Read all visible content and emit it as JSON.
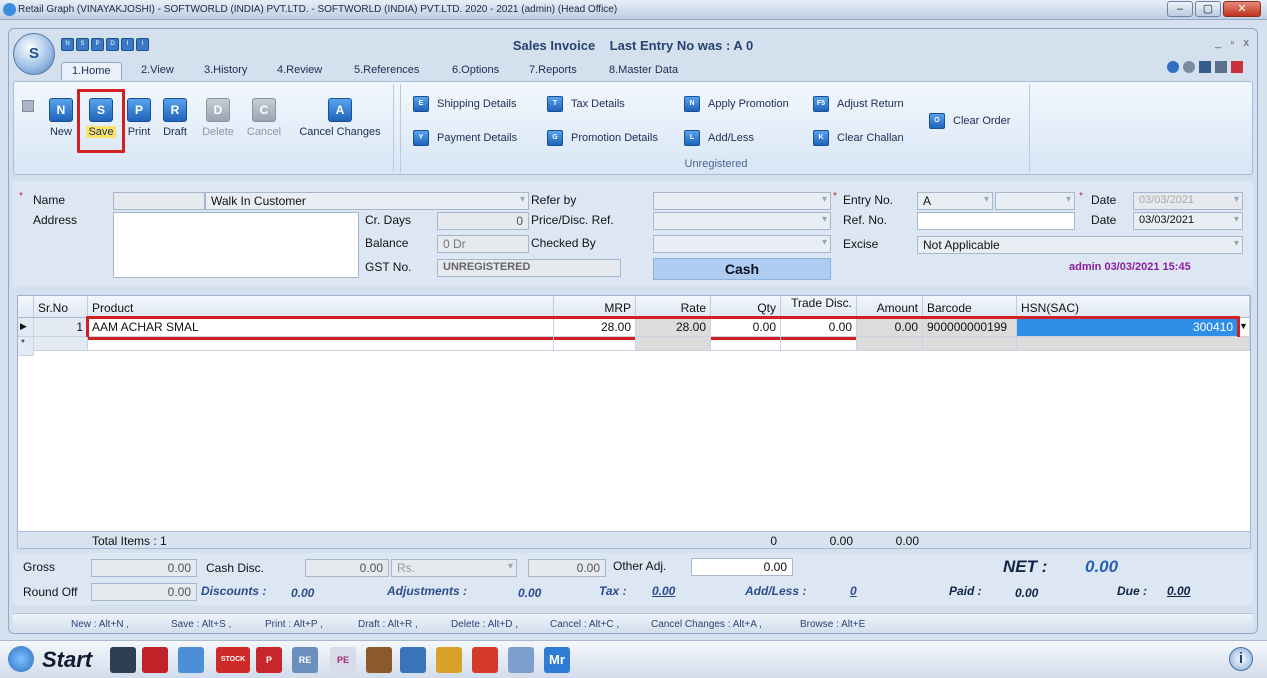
{
  "window": {
    "title": "Retail Graph (VINAYAKJOSHI) - SOFTWORLD (INDIA) PVT.LTD. - SOFTWORLD (INDIA) PVT.LTD. 2020 - 2021 (admin) (Head Office)",
    "min": "–",
    "max": "▢",
    "close": "✕"
  },
  "app": {
    "title": "Sales Invoice",
    "last_entry": "Last Entry No was : A 0",
    "orb": "S",
    "min": "_",
    "restore": "▫",
    "close": "x"
  },
  "qat": [
    "N",
    "S",
    "P",
    "D",
    "I",
    "I"
  ],
  "tabs": [
    "1.Home",
    "2.View",
    "3.History",
    "4.Review",
    "5.References",
    "6.Options",
    "7.Reports",
    "8.Master Data"
  ],
  "ribbon": {
    "buttons": [
      {
        "label": "New",
        "icon": "N"
      },
      {
        "label": "Save",
        "icon": "S"
      },
      {
        "label": "Print",
        "icon": "P"
      },
      {
        "label": "Draft",
        "icon": "R"
      },
      {
        "label": "Delete",
        "icon": "D"
      },
      {
        "label": "Cancel",
        "icon": "C"
      },
      {
        "label": "Cancel Changes",
        "icon": "A"
      }
    ],
    "small": [
      {
        "label": "Shipping Details",
        "icon": "E"
      },
      {
        "label": "Payment Details",
        "icon": "Y"
      },
      {
        "label": "Tax Details",
        "icon": "T"
      },
      {
        "label": "Promotion Details",
        "icon": "G"
      },
      {
        "label": "Apply Promotion",
        "icon": "N"
      },
      {
        "label": "Add/Less",
        "icon": "L"
      },
      {
        "label": "Adjust Return",
        "icon": "F5"
      },
      {
        "label": "Clear Challan",
        "icon": "K"
      },
      {
        "label": "Clear Order",
        "icon": "O"
      }
    ],
    "group_label": "Unregistered"
  },
  "form": {
    "name_label": "Name",
    "name_value": "Walk In Customer",
    "address_label": "Address",
    "crdays_label": "Cr. Days",
    "crdays_value": "0",
    "balance_label": "Balance",
    "balance_value": "0 Dr",
    "gst_label": "GST No.",
    "gst_value": "UNREGISTERED",
    "referby_label": "Refer by",
    "pricedisc_label": "Price/Disc. Ref.",
    "checkedby_label": "Checked By",
    "payment_mode": "Cash",
    "entryno_label": "Entry No.",
    "entryno_value": "A",
    "refno_label": "Ref. No.",
    "excise_label": "Excise",
    "excise_value": "Not Applicable",
    "date_label": "Date",
    "date1_value": "03/03/2021",
    "date2_value": "03/03/2021",
    "admin_stamp": "admin 03/03/2021 15:45",
    "asterisk": "*"
  },
  "grid": {
    "headers": [
      "Sr.No",
      "Product",
      "MRP",
      "Rate",
      "Qty",
      "Trade Disc.",
      "Amount",
      "Barcode",
      "HSN(SAC)"
    ],
    "row": {
      "marker": "▶",
      "sr": "1",
      "product": "AAM ACHAR SMAL",
      "mrp": "28.00",
      "rate": "28.00",
      "qty": "0.00",
      "trade": "0.00",
      "amount": "0.00",
      "barcode": "900000000199",
      "hsn": "300410"
    },
    "new_row_marker": "*",
    "totals": {
      "label": "Total Items : 1",
      "qty": "0",
      "trade": "0.00",
      "amount": "0.00"
    }
  },
  "footer": {
    "gross_label": "Gross",
    "gross_value": "0.00",
    "cashdisc_label": "Cash Disc.",
    "cashdisc_value": "0.00",
    "cashdisc_unit": "Rs.",
    "cashdisc_amt": "0.00",
    "otheradj_label": "Other Adj.",
    "otheradj_value": "0.00",
    "roundoff_label": "Round Off",
    "roundoff_value": "0.00",
    "discounts_label": "Discounts :",
    "discounts_value": "0.00",
    "adjustments_label": "Adjustments :",
    "adjustments_value": "0.00",
    "tax_label": "Tax :",
    "tax_value": "0.00",
    "addless_label": "Add/Less :",
    "addless_value": "0",
    "net_label": "NET :",
    "net_value": "0.00",
    "paid_label": "Paid :",
    "paid_value": "0.00",
    "due_label": "Due :",
    "due_value": "0.00"
  },
  "shortcuts": [
    "New : Alt+N ,",
    "Save : Alt+S ,",
    "Print : Alt+P ,",
    "Draft : Alt+R ,",
    "Delete : Alt+D ,",
    "Cancel : Alt+C ,",
    "Cancel Changes : Alt+A ,",
    "Browse : Alt+E"
  ],
  "taskbar": {
    "start": "Start",
    "icons": [
      "ledger-icon",
      "book-icon",
      "person-icon",
      "stock-icon",
      "p-icon",
      "re-icon",
      "report-icon",
      "tools-icon",
      "network-icon",
      "money-icon",
      "transfer-icon",
      "printer-icon",
      "mr-icon"
    ],
    "icon_labels": {
      "re": "RE",
      "mr": "Mr",
      "stock": "STOCK",
      "pe": "PE"
    },
    "info": "i"
  },
  "colors": {
    "accent": "#2f8fe8",
    "highlight": "#d21f1f",
    "admin": "#8b1fa0"
  }
}
